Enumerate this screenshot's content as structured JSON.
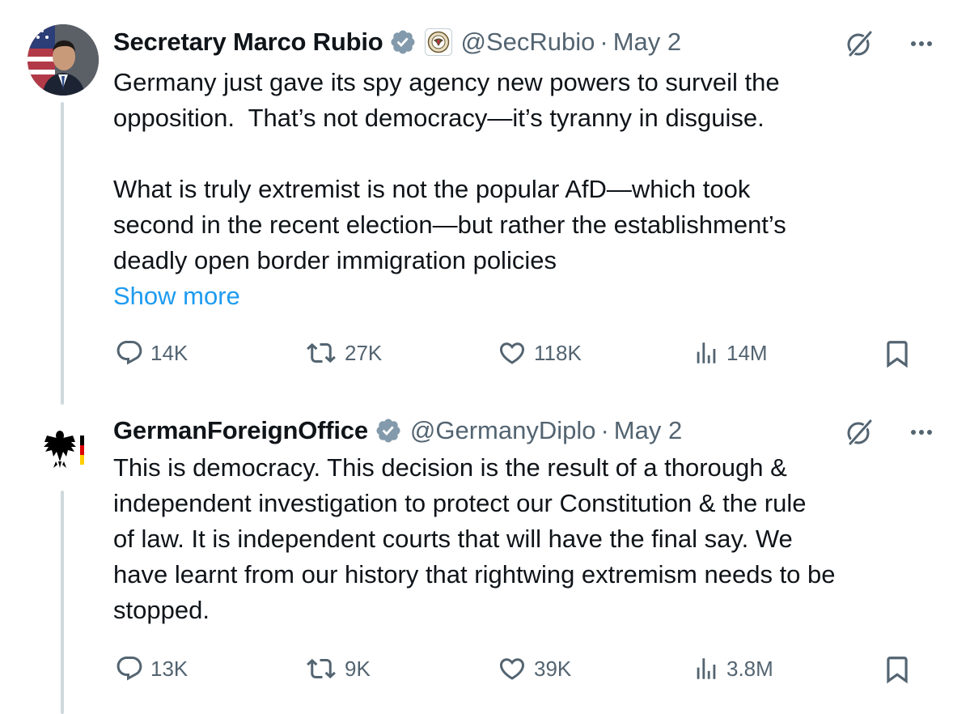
{
  "tweets": [
    {
      "name": "Secretary Marco Rubio",
      "handle": "@SecRubio",
      "separator": "·",
      "date": "May 2",
      "text": "Germany just gave its spy agency new powers to surveil the\nopposition.  That’s not democracy—it’s tyranny in disguise.\n\nWhat is truly extremist is not the popular AfD—which took\nsecond in the recent election—but rather the establishment’s\ndeadly open border immigration policies",
      "show_more": "Show more",
      "replies": "14K",
      "reposts": "27K",
      "likes": "118K",
      "views": "14M",
      "avatar_icon": "person-photo-avatar",
      "verified_icon": "verified-badge-icon",
      "affiliate_icon": "state-department-seal-icon"
    },
    {
      "name": "GermanForeignOffice",
      "handle": "@GermanyDiplo",
      "separator": "·",
      "date": "May 2",
      "text": "This is democracy. This decision is the result of a thorough &\nindependent investigation to protect our Constitution & the rule\nof law. It is independent courts that will have the final say. We\nhave learnt from our history that rightwing extremism needs to be\nstopped.",
      "replies": "13K",
      "reposts": "9K",
      "likes": "39K",
      "views": "3.8M",
      "avatar_icon": "federal-eagle-avatar",
      "verified_icon": "verified-badge-icon"
    }
  ],
  "colors": {
    "text": "#0f1419",
    "secondary": "#536471",
    "link": "#1d9bf0",
    "badge": "#829aab",
    "thread_line": "#cfd9de"
  }
}
